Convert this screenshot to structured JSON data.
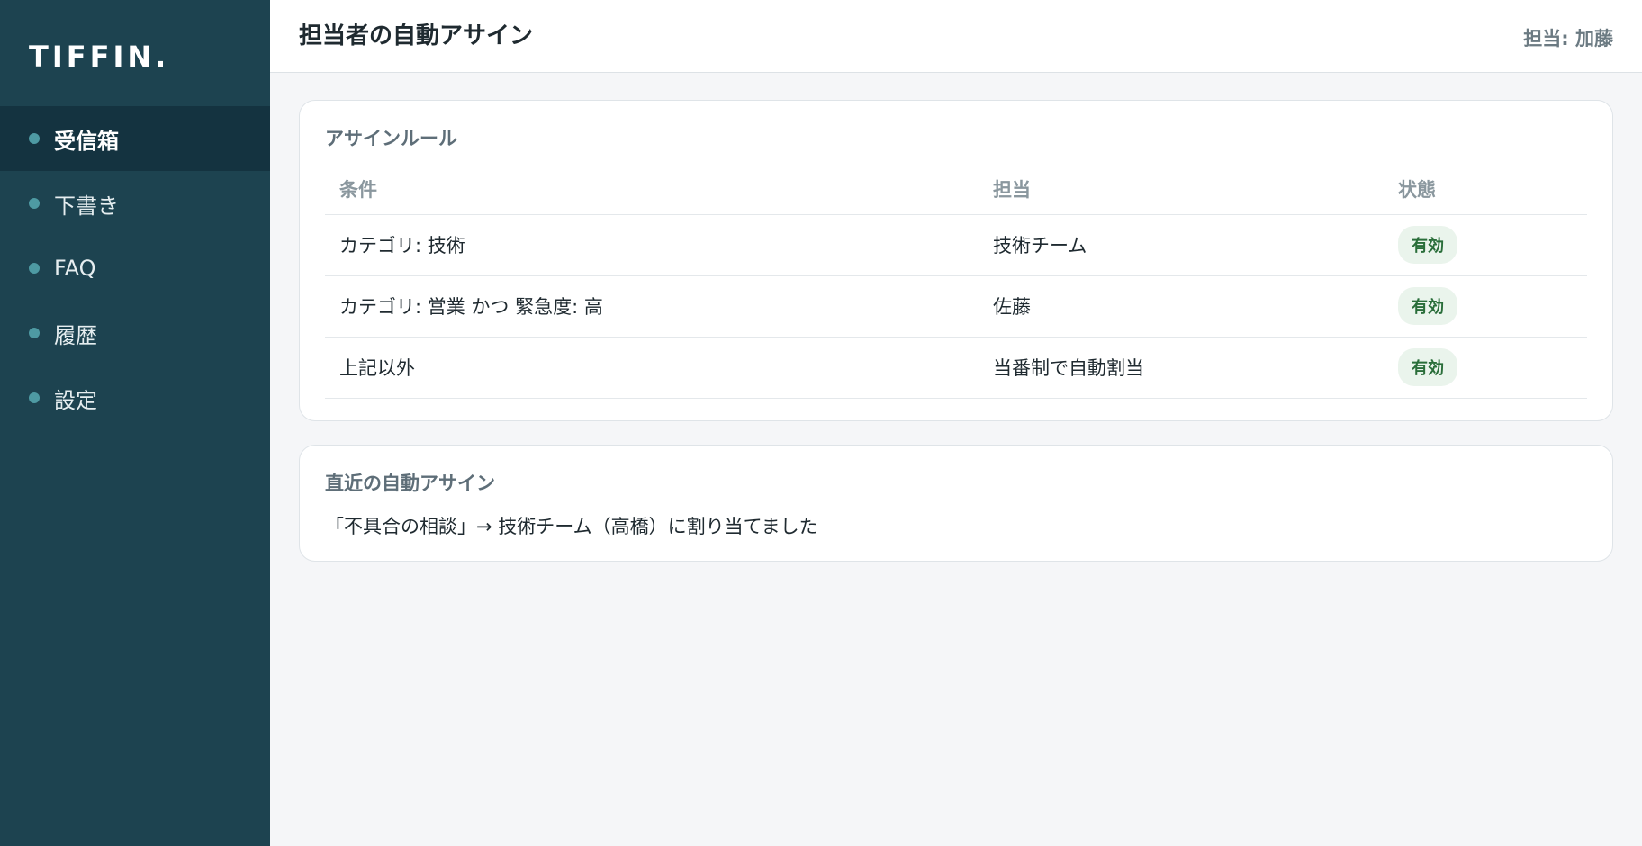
{
  "brand": {
    "logo_text": "TIFFIN."
  },
  "sidebar": {
    "items": [
      {
        "label": "受信箱",
        "active": true
      },
      {
        "label": "下書き",
        "active": false
      },
      {
        "label": "FAQ",
        "active": false
      },
      {
        "label": "履歴",
        "active": false
      },
      {
        "label": "設定",
        "active": false
      }
    ]
  },
  "header": {
    "title": "担当者の自動アサイン",
    "user": "担当: 加藤"
  },
  "rules_card": {
    "title": "アサインルール",
    "columns": [
      "条件",
      "担当",
      "状態"
    ],
    "rows": [
      {
        "condition": "カテゴリ: 技術",
        "assignee": "技術チーム",
        "status": "有効"
      },
      {
        "condition": "カテゴリ: 営業 かつ 緊急度: 高",
        "assignee": "佐藤",
        "status": "有効"
      },
      {
        "condition": "上記以外",
        "assignee": "当番制で自動割当",
        "status": "有効"
      }
    ]
  },
  "recent_card": {
    "title": "直近の自動アサイン",
    "message": "「不具合の相談」→ 技術チーム（高橋）に割り当てました"
  },
  "colors": {
    "sidebar_bg": "#1d4350",
    "sidebar_active_bg": "#143340",
    "accent_dot": "#4e9aa3",
    "badge_bg": "#eaf4ec",
    "badge_text": "#2a6e3a"
  }
}
